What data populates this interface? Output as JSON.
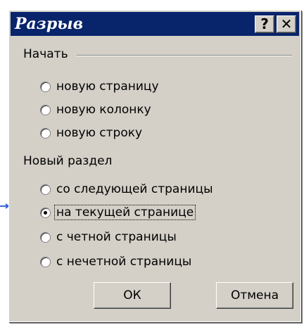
{
  "window": {
    "title": "Разрыв",
    "help_label": "?",
    "close_label": "✕"
  },
  "start_group": {
    "label": "Начать",
    "options": [
      {
        "label": "новую страницу",
        "selected": false
      },
      {
        "label": "новую колонку",
        "selected": false
      },
      {
        "label": "новую строку",
        "selected": false
      }
    ]
  },
  "section_group": {
    "label": "Новый раздел",
    "options": [
      {
        "label": "со следующей страницы",
        "selected": false
      },
      {
        "label": "на текущей странице",
        "selected": true
      },
      {
        "label": "с четной страницы",
        "selected": false
      },
      {
        "label": "с нечетной страницы",
        "selected": false
      }
    ]
  },
  "buttons": {
    "ok": "ОК",
    "cancel": "Отмена"
  },
  "colors": {
    "titlebar": "#08246b",
    "face": "#d4d0c8",
    "pointer_arrow": "#3c6ad2"
  }
}
